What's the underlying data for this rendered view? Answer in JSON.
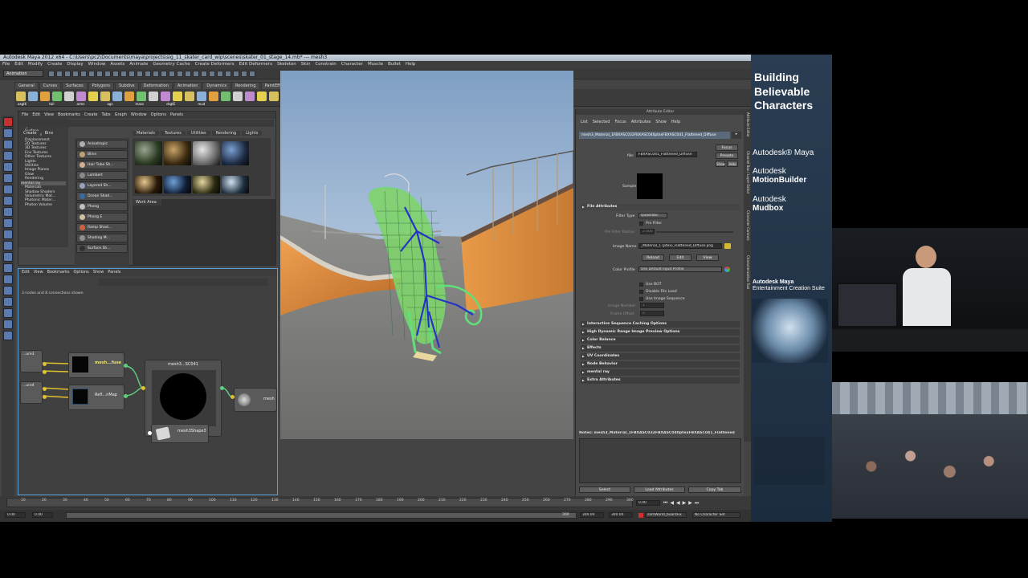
{
  "maya": {
    "window_title": "Autodesk Maya 2012 x64 - C:\\Users\\pc2\\Documents\\maya\\projects\\sig_11_skater_card_wip\\scenes\\skater_01_stage_14.mb* --- mesh3",
    "menu": [
      "File",
      "Edit",
      "Modify",
      "Create",
      "Display",
      "Window",
      "Assets",
      "Animate",
      "Geometry Cache",
      "Create Deformers",
      "Edit Deformers",
      "Skeleton",
      "Skin",
      "Constrain",
      "Character",
      "Muscle",
      "Bullet",
      "Help"
    ],
    "mode": "Animation",
    "quick_field": "mesh3",
    "shelf_tabs": [
      "General",
      "Curves",
      "Surfaces",
      "Polygons",
      "Subdivs",
      "Deformation",
      "Animation",
      "Dynamics",
      "Rendering",
      "PaintEffects",
      "Toon",
      "Muscle",
      "Fluids",
      "Fur",
      "Hair",
      "nCloth",
      "Custom",
      "puffy"
    ],
    "shelf_active": "Custom",
    "shelf_labels": [
      "osgHi",
      "tail",
      "arms",
      "ogs",
      "mass",
      "dsgtE",
      "mud"
    ],
    "hypershade": {
      "menu": [
        "File",
        "Edit",
        "View",
        "Bookmarks",
        "Create",
        "Tabs",
        "Graph",
        "Window",
        "Options",
        "Panels"
      ],
      "create_tabs": [
        "Create",
        "Bins"
      ],
      "tree": [
        "Favorites",
        "Maya",
        "Surface",
        "Volumetric",
        "Displacement",
        "2D Textures",
        "3D Textures",
        "Env Textures",
        "Other Textures",
        "Lights",
        "Utilities",
        "Image Planes",
        "Glow",
        "Rendering",
        "mental ray",
        "Materials",
        "Shadow Shaders",
        "Volumetric Mat...",
        "Photonic Mater...",
        "Photon Volume"
      ],
      "shader_list": [
        "Anisotropic",
        "Blinn",
        "Hair Tube Sh...",
        "Lambert",
        "Layered Sh...",
        "Ocean Shad...",
        "Phong",
        "Phong E",
        "Ramp Shad...",
        "Shading M...",
        "Surface Sh..."
      ],
      "tabs": [
        "Materials",
        "Textures",
        "Utilities",
        "Rendering",
        "Lights"
      ],
      "swatches": [
        "Chameleo...",
        "Trashc...",
        "Trashc...",
        "Trashc..."
      ],
      "work_area": "Work Area"
    },
    "node_editor": {
      "menu": [
        "Edit",
        "View",
        "Bookmarks",
        "Options",
        "Show",
        "Panels"
      ],
      "info": "3 nodes and 8 connections shown",
      "nodes": [
        "mesh3...SC041",
        "...ure3",
        "...ure4",
        "mesh...fuse",
        "Refl...nMap",
        "mesh3Shape3",
        "mesh",
        "shape2",
        "mesh"
      ]
    },
    "viewport": {
      "menu": [
        "View",
        "Shading",
        "Lighting",
        "Show",
        "Renderer",
        "Panels"
      ]
    },
    "attribute_editor": {
      "title": "Attribute Editor",
      "menu": [
        "List",
        "Selected",
        "Focus",
        "Attributes",
        "Show",
        "Help"
      ],
      "node_tab": "mesh3_Material_1FBXASC032FBXASC040ptexFBXASC041_Flattened_Diffuse",
      "file_label": "file:",
      "file_value": "FBXASC041_Flattened_Diffuse",
      "buttons_right": [
        "Focus",
        "Presets",
        "Show",
        "Hide"
      ],
      "sample_label": "Sample",
      "section_file": "File Attributes",
      "filter_type_label": "Filter Type",
      "filter_type_value": "Quadratic",
      "pre_filter": "Pre Filter",
      "pre_filter_radius": "Pre Filter Radius",
      "pre_filter_radius_value": "2.000",
      "image_name_label": "Image Name",
      "image_name_value": "_Material_1 (ptex)_Flattened_Diffuse.png",
      "image_buttons": [
        "Reload",
        "Edit",
        "View"
      ],
      "color_profile_label": "Color Profile",
      "color_profile_value": "Use Default Input Profile",
      "checkboxes": [
        "Use BOT",
        "Disable File Load",
        "Use Image Sequence"
      ],
      "image_number_label": "Image Number",
      "image_number_value": "1",
      "frame_offset_label": "Frame Offset",
      "frame_offset_value": "0",
      "sections": [
        "Interactive Sequence Caching Options",
        "High Dynamic Range Image Preview Options",
        "Color Balance",
        "Effects",
        "UV Coordinates",
        "Node Behavior",
        "mental ray",
        "Extra Attributes"
      ],
      "notes": "Notes:  mesh3_Material_1FBXASC032FBXASC040ptexFBXASC041_Flattened",
      "bottom_buttons": [
        "Select",
        "Load Attributes",
        "Copy Tab"
      ],
      "side_tabs": [
        "Attribute Editor",
        "Channel Box / Layer Editor",
        "Character Controls",
        "Characterization Tool"
      ]
    },
    "timeline": {
      "ticks": [
        "10",
        "20",
        "30",
        "40",
        "50",
        "60",
        "70",
        "80",
        "90",
        "100",
        "110",
        "120",
        "130",
        "140",
        "150",
        "160",
        "170",
        "180",
        "190",
        "200",
        "210",
        "220",
        "230",
        "240",
        "250",
        "260",
        "270",
        "280",
        "290",
        "300"
      ],
      "current_frame": "0.00",
      "start": "0.00",
      "start2": "0.00",
      "end": "300",
      "end2": "300.00",
      "end3": "300.00",
      "anim_layer": "samWorld_boardFix",
      "character_set": "No Character Set"
    }
  },
  "branding": {
    "headline": [
      "Building",
      "Believable",
      "Characters"
    ],
    "products": [
      {
        "line1": "Autodesk",
        "line2": "Maya",
        "style": "inline"
      },
      {
        "line1": "Autodesk",
        "line2": "MotionBuilder",
        "style": "stacked"
      },
      {
        "line1": "Autodesk",
        "line2": "Mudbox",
        "style": "stacked"
      },
      {
        "line1": "Autodesk Maya",
        "line2": "Entertainment Creation Suite",
        "style": "stacked"
      }
    ]
  },
  "colors": {
    "panel": "#474747",
    "accent_teal": "#5e8a96",
    "ae_bg": "#4a4a4a",
    "sky_top": "#7f9fc4",
    "ramp_orange": "#d98a3a",
    "wire_green": "#5fe07a",
    "brand_blue": "#24364b"
  }
}
